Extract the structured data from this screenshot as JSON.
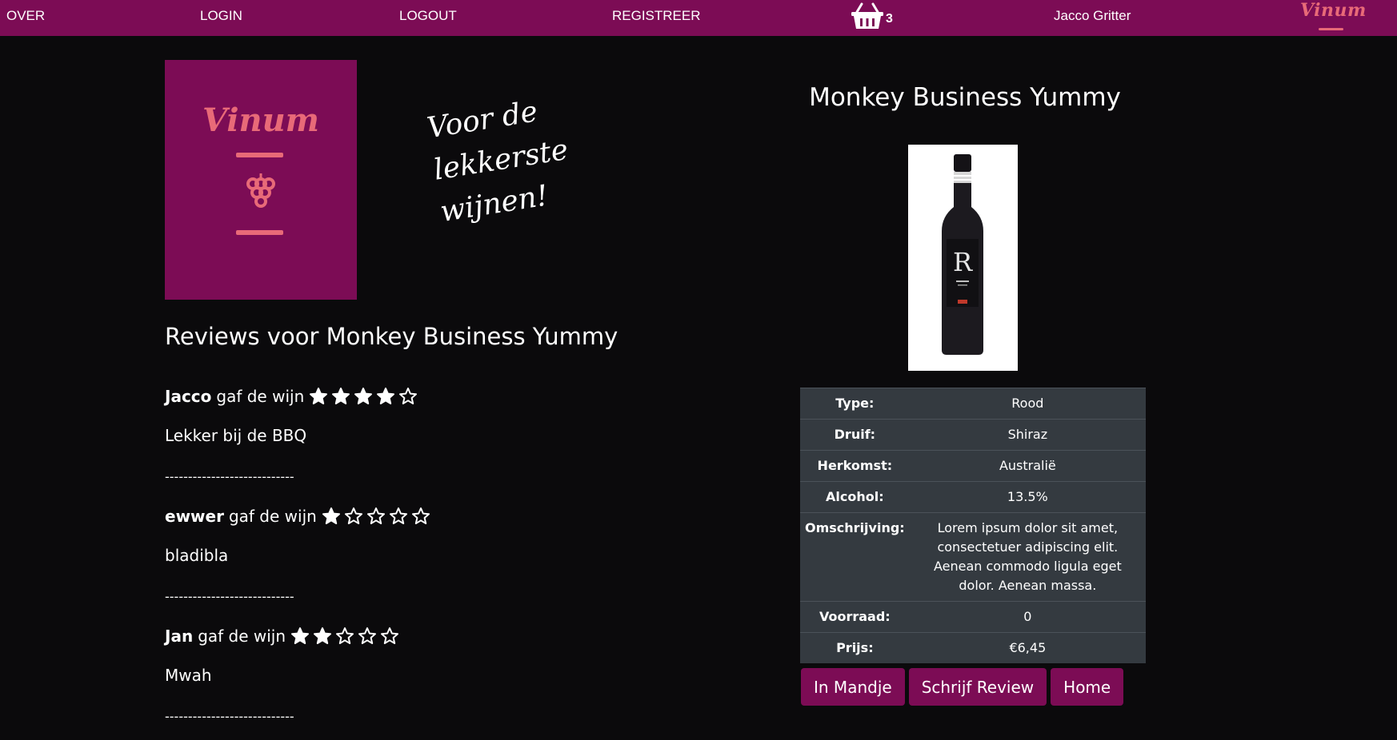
{
  "nav": {
    "links": [
      "OVER",
      "LOGIN",
      "LOGOUT",
      "REGISTREER"
    ],
    "cart_count": "3",
    "user": "Jacco Gritter",
    "brand": "Vinum"
  },
  "colors": {
    "brand": "#7c0c55",
    "accent": "#e86a78",
    "background": "#0b0a0c",
    "table": "#343a40"
  },
  "logo": {
    "word": "Vinum"
  },
  "tagline": [
    "Voor de",
    "lekkerste",
    "wijnen!"
  ],
  "reviews": {
    "title": "Reviews voor Monkey Business Yummy",
    "gaf_text": "gaf de wijn",
    "separator": "----------------------------",
    "items": [
      {
        "user": "Jacco",
        "rating": 4,
        "text": "Lekker bij de BBQ"
      },
      {
        "user": "ewwer",
        "rating": 1,
        "text": "bladibla"
      },
      {
        "user": "Jan",
        "rating": 2,
        "text": "Mwah"
      }
    ]
  },
  "product": {
    "title": "Monkey Business Yummy",
    "details": [
      {
        "label": "Type:",
        "value": "Rood"
      },
      {
        "label": "Druif:",
        "value": "Shiraz"
      },
      {
        "label": "Herkomst:",
        "value": "Australië"
      },
      {
        "label": "Alcohol:",
        "value": "13.5%"
      },
      {
        "label": "Omschrijving:",
        "value": "Lorem ipsum dolor sit amet, consectetuer adipiscing elit. Aenean commodo ligula eget dolor. Aenean massa."
      },
      {
        "label": "Voorraad:",
        "value": "0"
      },
      {
        "label": "Prijs:",
        "value": "€6,45"
      }
    ]
  },
  "buttons": {
    "cart": "In Mandje",
    "review": "Schrijf Review",
    "home": "Home"
  }
}
